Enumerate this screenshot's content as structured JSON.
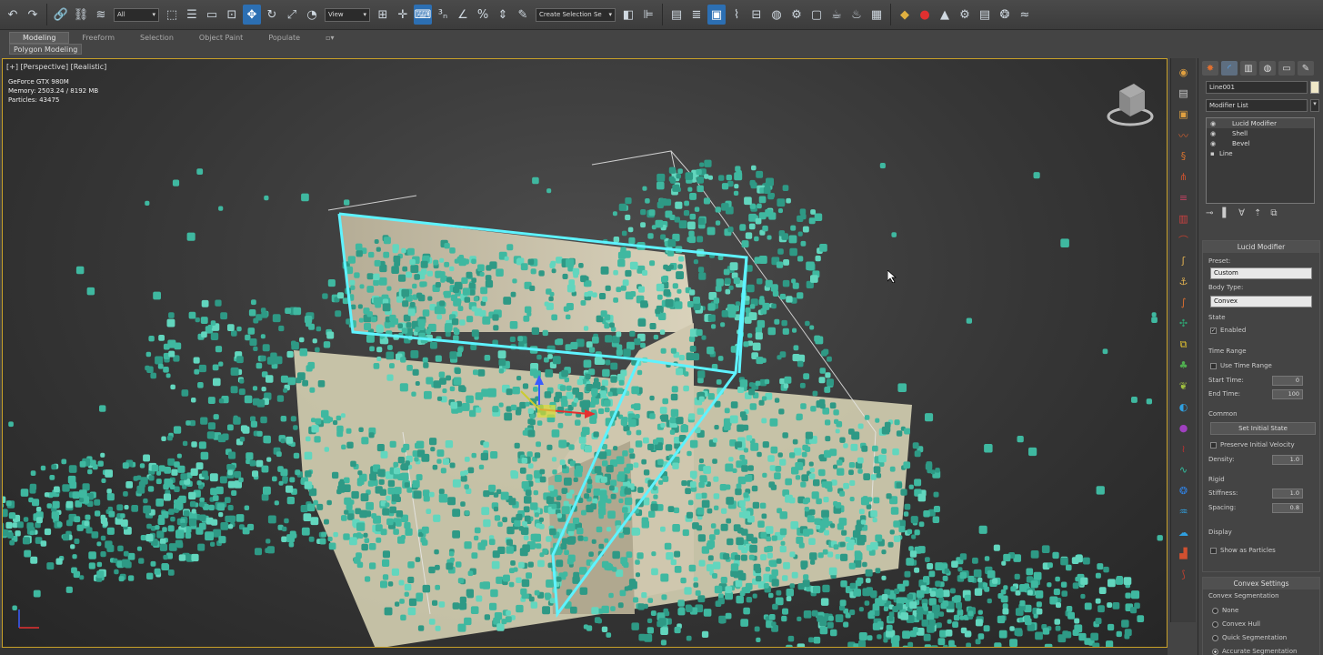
{
  "toolbar": {
    "selection_filter": "All",
    "ref_coord": "View",
    "named_selection": "Create Selection Se"
  },
  "ribbon": {
    "tabs": [
      "Modeling",
      "Freeform",
      "Selection",
      "Object Paint",
      "Populate"
    ],
    "active_tab": "Modeling",
    "panel_label": "Polygon Modeling"
  },
  "viewport": {
    "label": "[+] [Perspective] [Realistic]",
    "stats": [
      "GeForce GTX 980M",
      "Memory: 2503.24 / 8192 MB",
      "Particles: 43475"
    ]
  },
  "command_panel": {
    "object_name": "Line001",
    "modifier_list": "Modifier List",
    "stack": [
      "Lucid Modifier",
      "Shell",
      "Bevel",
      "Line"
    ],
    "lucid": {
      "title": "Lucid Modifier",
      "preset_label": "Preset:",
      "preset_value": "Custom",
      "body_type_label": "Body Type:",
      "body_type_value": "Convex",
      "state_group": "State",
      "enabled_label": "Enabled",
      "time_range_group": "Time Range",
      "use_time_range_label": "Use Time Range",
      "start_time_label": "Start Time:",
      "start_time_value": "0",
      "end_time_label": "End Time:",
      "end_time_value": "100",
      "common_group": "Common",
      "set_initial_state": "Set Initial State",
      "preserve_velocity_label": "Preserve Initial Velocity",
      "density_label": "Density:",
      "density_value": "1.0",
      "rigid_group": "Rigid",
      "stiffness_label": "Stiffness:",
      "stiffness_value": "1.0",
      "spacing_label": "Spacing:",
      "spacing_value": "0.8",
      "display_group": "Display",
      "show_particles_label": "Show as Particles"
    },
    "convex": {
      "title": "Convex Settings",
      "segmentation_group": "Convex Segmentation",
      "options": [
        "None",
        "Convex Hull",
        "Quick Segmentation",
        "Accurate Segmentation"
      ],
      "selected": "Accurate Segmentation"
    }
  },
  "colors": {
    "particle": "#3fb8a0",
    "selection_outline": "#5ef3ff",
    "viewport_border": "#c8a028"
  }
}
